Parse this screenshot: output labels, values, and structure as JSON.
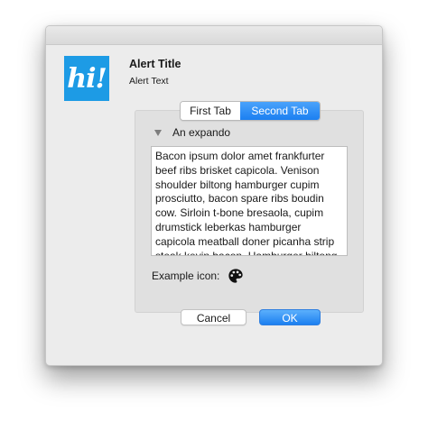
{
  "app_icon": {
    "text": "hi!",
    "color": "#1d9be5"
  },
  "alert": {
    "title": "Alert Title",
    "text": "Alert Text"
  },
  "tabs": [
    {
      "label": "First Tab",
      "selected": false
    },
    {
      "label": "Second Tab",
      "selected": true
    }
  ],
  "expando": {
    "label": "An expando",
    "icon": "disclosure-triangle-icon",
    "expanded": true
  },
  "text_area": {
    "value": "Bacon ipsum dolor amet frankfurter beef ribs brisket capicola. Venison shoulder biltong hamburger cupim prosciutto, bacon spare ribs boudin cow. Sirloin t-bone bresaola, cupim drumstick leberkas hamburger capicola meatball doner picanha strip steak kevin bacon. Hamburger biltong"
  },
  "example": {
    "label": "Example icon:",
    "icon": "palette-icon"
  },
  "buttons": {
    "cancel": "Cancel",
    "ok": "OK"
  },
  "colors": {
    "accent": "#1b7ff1",
    "dialog_background": "#ececec"
  }
}
